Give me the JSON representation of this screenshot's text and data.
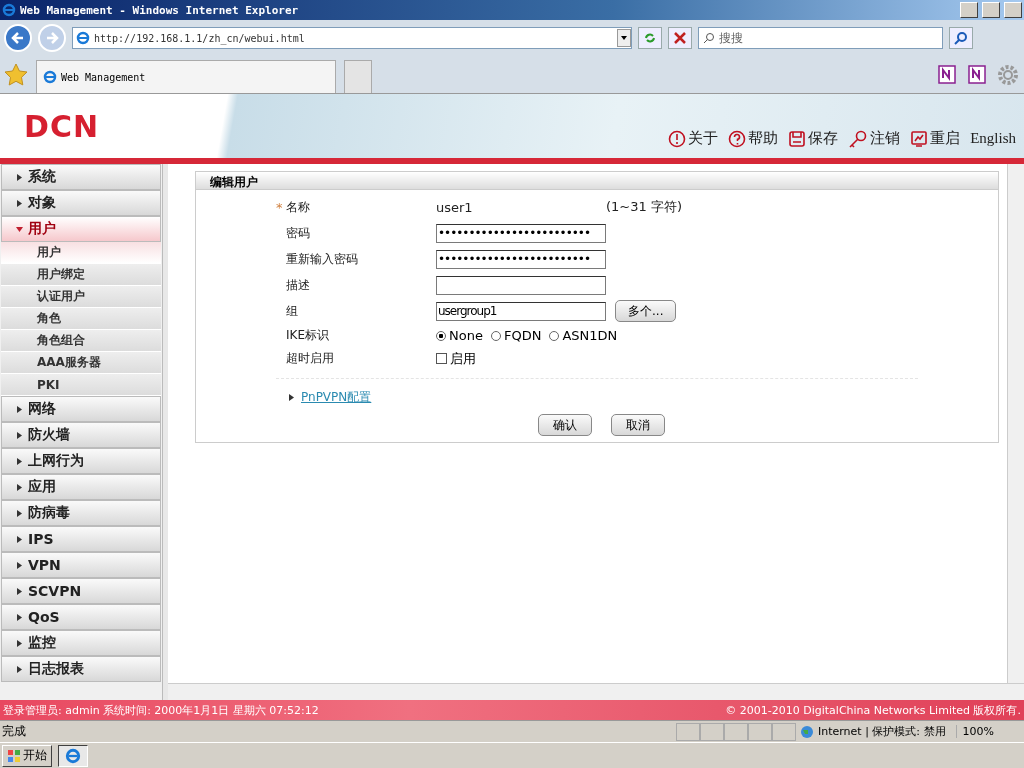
{
  "browser": {
    "title": "Web Management - Windows Internet Explorer",
    "address": "http://192.168.1.1/zh_cn/webui.html",
    "search_placeholder": "搜搜",
    "tab": "Web Management"
  },
  "header": {
    "logo": "DCN",
    "actions": [
      {
        "kind": "about",
        "label": "关于"
      },
      {
        "kind": "help",
        "label": "帮助"
      },
      {
        "kind": "save",
        "label": "保存"
      },
      {
        "kind": "logout",
        "label": "注销"
      },
      {
        "kind": "restart",
        "label": "重启"
      },
      {
        "kind": "language",
        "label": "English"
      }
    ]
  },
  "sidebar": {
    "items": [
      {
        "label": "系统",
        "expanded": false
      },
      {
        "label": "对象",
        "expanded": false
      },
      {
        "label": "用户",
        "expanded": true,
        "children": [
          {
            "label": "用户",
            "selected": true
          },
          {
            "label": "用户绑定",
            "selected": false
          },
          {
            "label": "认证用户",
            "selected": false
          },
          {
            "label": "角色",
            "selected": false
          },
          {
            "label": "角色组合",
            "selected": false
          },
          {
            "label": "AAA服务器",
            "selected": false
          },
          {
            "label": "PKI",
            "selected": false
          }
        ]
      },
      {
        "label": "网络",
        "expanded": false
      },
      {
        "label": "防火墙",
        "expanded": false
      },
      {
        "label": "上网行为",
        "expanded": false
      },
      {
        "label": "应用",
        "expanded": false
      },
      {
        "label": "防病毒",
        "expanded": false
      },
      {
        "label": "IPS",
        "expanded": false
      },
      {
        "label": "VPN",
        "expanded": false
      },
      {
        "label": "SCVPN",
        "expanded": false
      },
      {
        "label": "QoS",
        "expanded": false
      },
      {
        "label": "监控",
        "expanded": false
      },
      {
        "label": "日志报表",
        "expanded": false
      }
    ]
  },
  "form": {
    "title": "编辑用户",
    "fields": [
      {
        "kind": "text",
        "mark": "*",
        "label": "名称",
        "value": "user1",
        "hint": "(1~31 字符)"
      },
      {
        "kind": "input",
        "label": "密码",
        "value": "•••••••••••••••••••••••••"
      },
      {
        "kind": "input",
        "label": "重新输入密码",
        "value": "•••••••••••••••••••••••••"
      },
      {
        "kind": "input",
        "label": "描述"
      },
      {
        "kind": "input",
        "label": "组",
        "value": "usergroup1",
        "button": "多个..."
      },
      {
        "kind": "radio",
        "label": "IKE标识",
        "options": [
          {
            "label": "None",
            "selected": true
          },
          {
            "label": "FQDN",
            "selected": false
          },
          {
            "label": "ASN1DN",
            "selected": false
          }
        ]
      },
      {
        "kind": "checkbox",
        "label": "超时启用",
        "checked": false,
        "option": "启用"
      }
    ],
    "link": "PnPVPN配置",
    "buttons": [
      "确认",
      "取消"
    ]
  },
  "footer": {
    "login": "登录管理员: admin 系统时间: 2000年1月1日 星期六 07:52:12",
    "copyright": "© 2001-2010 DigitalChina Networks Limited 版权所有."
  },
  "status_bar": {
    "text": "完成",
    "zone": "Internet | 保护模式: 禁用",
    "zoom": "100%"
  },
  "taskbar": {
    "start": "开始"
  }
}
